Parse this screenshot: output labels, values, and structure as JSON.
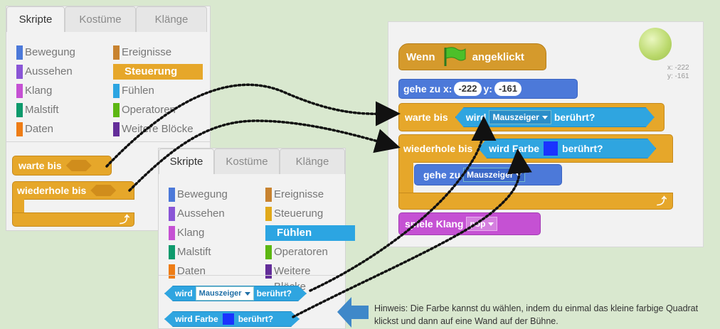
{
  "tabs": [
    "Skripte",
    "Kostüme",
    "Klänge"
  ],
  "categories_left": [
    "Bewegung",
    "Aussehen",
    "Klang",
    "Malstift",
    "Daten"
  ],
  "categories_right": [
    "Ereignisse",
    "Steuerung",
    "Fühlen",
    "Operatoren",
    "Weitere Blöcke"
  ],
  "category_colors": {
    "Bewegung": "#4c79d9",
    "Aussehen": "#8a55d6",
    "Klang": "#c551d3",
    "Malstift": "#0e9a6c",
    "Daten": "#ee7d16",
    "Ereignisse": "#c88330",
    "Steuerung": "#e1a91a",
    "Fühlen": "#2ca5e2",
    "Operatoren": "#5cb712",
    "Weitere Blöcke": "#632d99"
  },
  "panel1": {
    "selected": "Steuerung",
    "selected_color": "#e6a72a"
  },
  "panel2": {
    "selected": "Fühlen",
    "selected_color": "#2ca5e2"
  },
  "palette_blocks": {
    "warte_bis": "warte bis",
    "wiederhole_bis": "wiederhole bis"
  },
  "sensing_blocks": {
    "wird_label": "wird",
    "mauszeiger": "Mauszeiger",
    "beruehrt": "berührt?",
    "farbe_label": "wird Farbe",
    "color": "#1a33ff"
  },
  "script": {
    "hat_pre": "Wenn",
    "hat_post": "angeklickt",
    "goto_label": "gehe zu x:",
    "x_value": "-222",
    "y_label": "y:",
    "y_value": "-161",
    "wait_label": "warte bis",
    "repeat_label": "wiederhole bis",
    "goto2_label": "gehe zu",
    "goto2_target": "Mauszeiger",
    "sound_label": "spiele Klang",
    "sound_value": "pop"
  },
  "stage": {
    "x_readout": "x: -222",
    "y_readout": "y: -161"
  },
  "hint": "Hinweis: Die Farbe kannst du wählen, indem du einmal das kleine farbige Quadrat klickst und dann auf eine Wand auf der Bühne."
}
